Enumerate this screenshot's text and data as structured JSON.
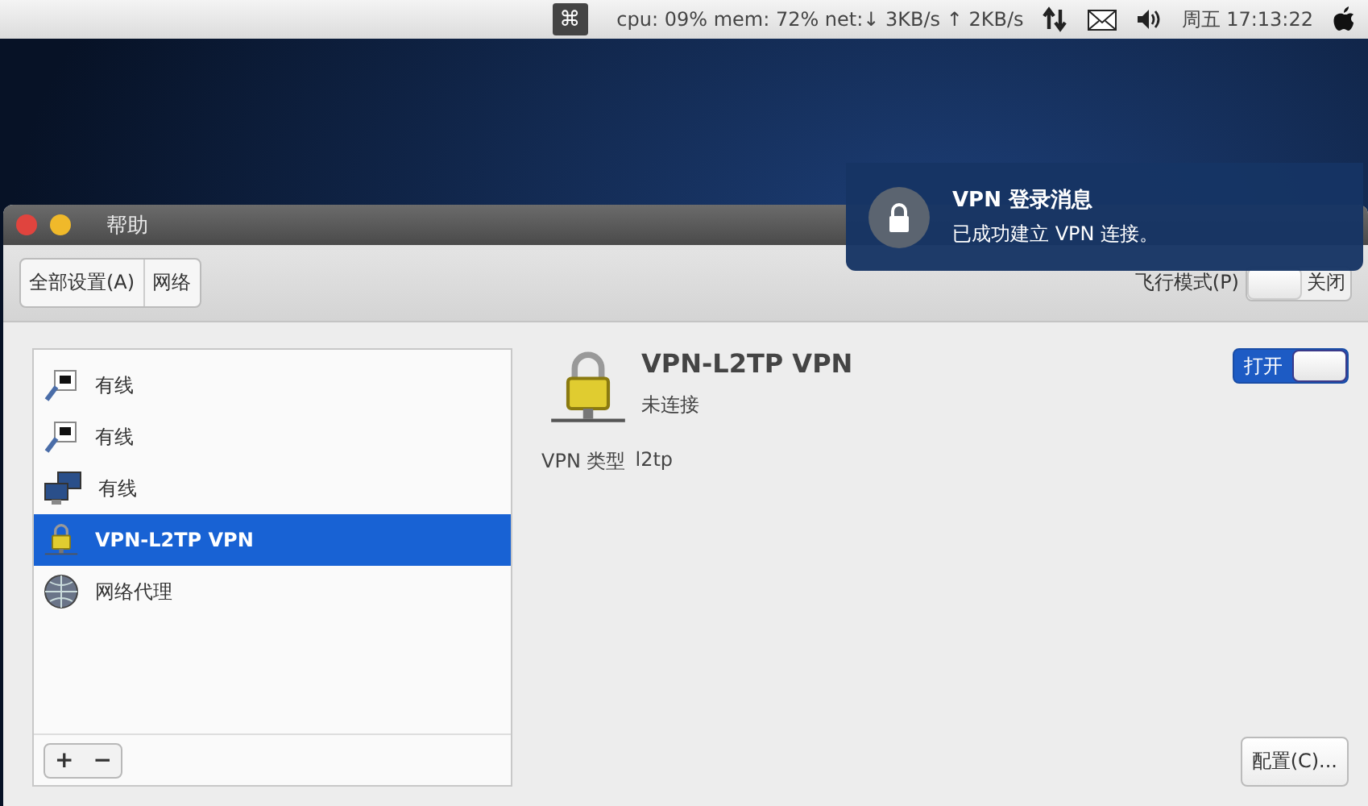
{
  "menubar": {
    "command_key": "⌘",
    "stats": "cpu: 09% mem: 72% net:↓  3KB/s ↑  2KB/s",
    "clock": "周五 17:13:22"
  },
  "notification": {
    "title": "VPN  登录消息",
    "body": "已成功建立 VPN 连接。"
  },
  "window": {
    "title": "帮助"
  },
  "toolbar": {
    "breadcrumbs": [
      "全部设置(A)",
      "网络"
    ],
    "airplane": {
      "label": "飞行模式(P)",
      "on": false,
      "state_text": "关闭"
    }
  },
  "sidebar": {
    "items": [
      {
        "kind": "wired",
        "label": "有线",
        "selected": false
      },
      {
        "kind": "wired",
        "label": "有线",
        "selected": false
      },
      {
        "kind": "network",
        "label": "有线",
        "selected": false
      },
      {
        "kind": "vpn",
        "label": "VPN-L2TP VPN",
        "selected": true
      },
      {
        "kind": "proxy",
        "label": "网络代理",
        "selected": false
      }
    ],
    "add": "+",
    "remove": "−"
  },
  "detail": {
    "name": "VPN-L2TP VPN",
    "status": "未连接",
    "toggle": {
      "on": true,
      "state_text": "打开"
    },
    "type_label": "VPN 类型",
    "type_value": "l2tp",
    "configure": "配置(C)..."
  }
}
